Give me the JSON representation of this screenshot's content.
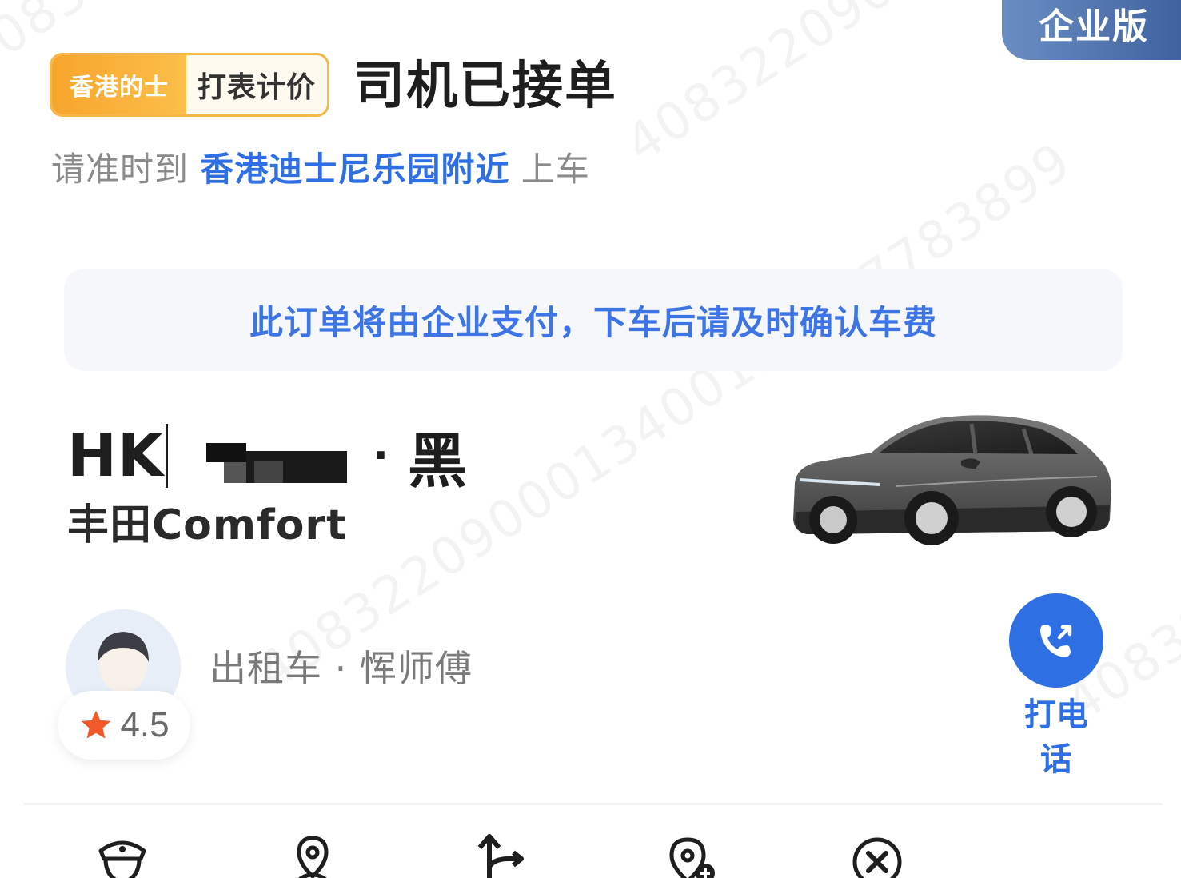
{
  "header": {
    "enterprise_badge": "企业版",
    "tag_service": "香港的士",
    "tag_pricing": "打表计价",
    "status_title": "司机已接单",
    "pickup_prefix": "请准时到",
    "pickup_location": "香港迪士尼乐园附近",
    "pickup_suffix": "上车"
  },
  "notice": {
    "text": "此订单将由企业支付，下车后请及时确认车费"
  },
  "vehicle": {
    "plate_prefix": "HK",
    "plate_separator": "·",
    "color": "黑",
    "model": "丰田Comfort",
    "image_icon": "car-icon"
  },
  "driver": {
    "rating": "4.5",
    "info": "出租车 · 恽师傅",
    "call_label": "打电话",
    "avatar_icon": "driver-avatar-icon",
    "call_icon": "phone-call-icon"
  },
  "toolbar": {
    "items": [
      {
        "icon": "police-shield-icon"
      },
      {
        "icon": "location-share-icon"
      },
      {
        "icon": "route-change-icon"
      },
      {
        "icon": "add-stop-icon"
      },
      {
        "icon": "cancel-order-icon"
      }
    ]
  },
  "watermark": {
    "text": "4083220900013400197737783899"
  },
  "colors": {
    "accent_blue": "#2f6fe4",
    "badge_orange": "#f7a52c",
    "notice_bg": "#f5f7fa",
    "enterprise_badge": "#4f71ad"
  }
}
